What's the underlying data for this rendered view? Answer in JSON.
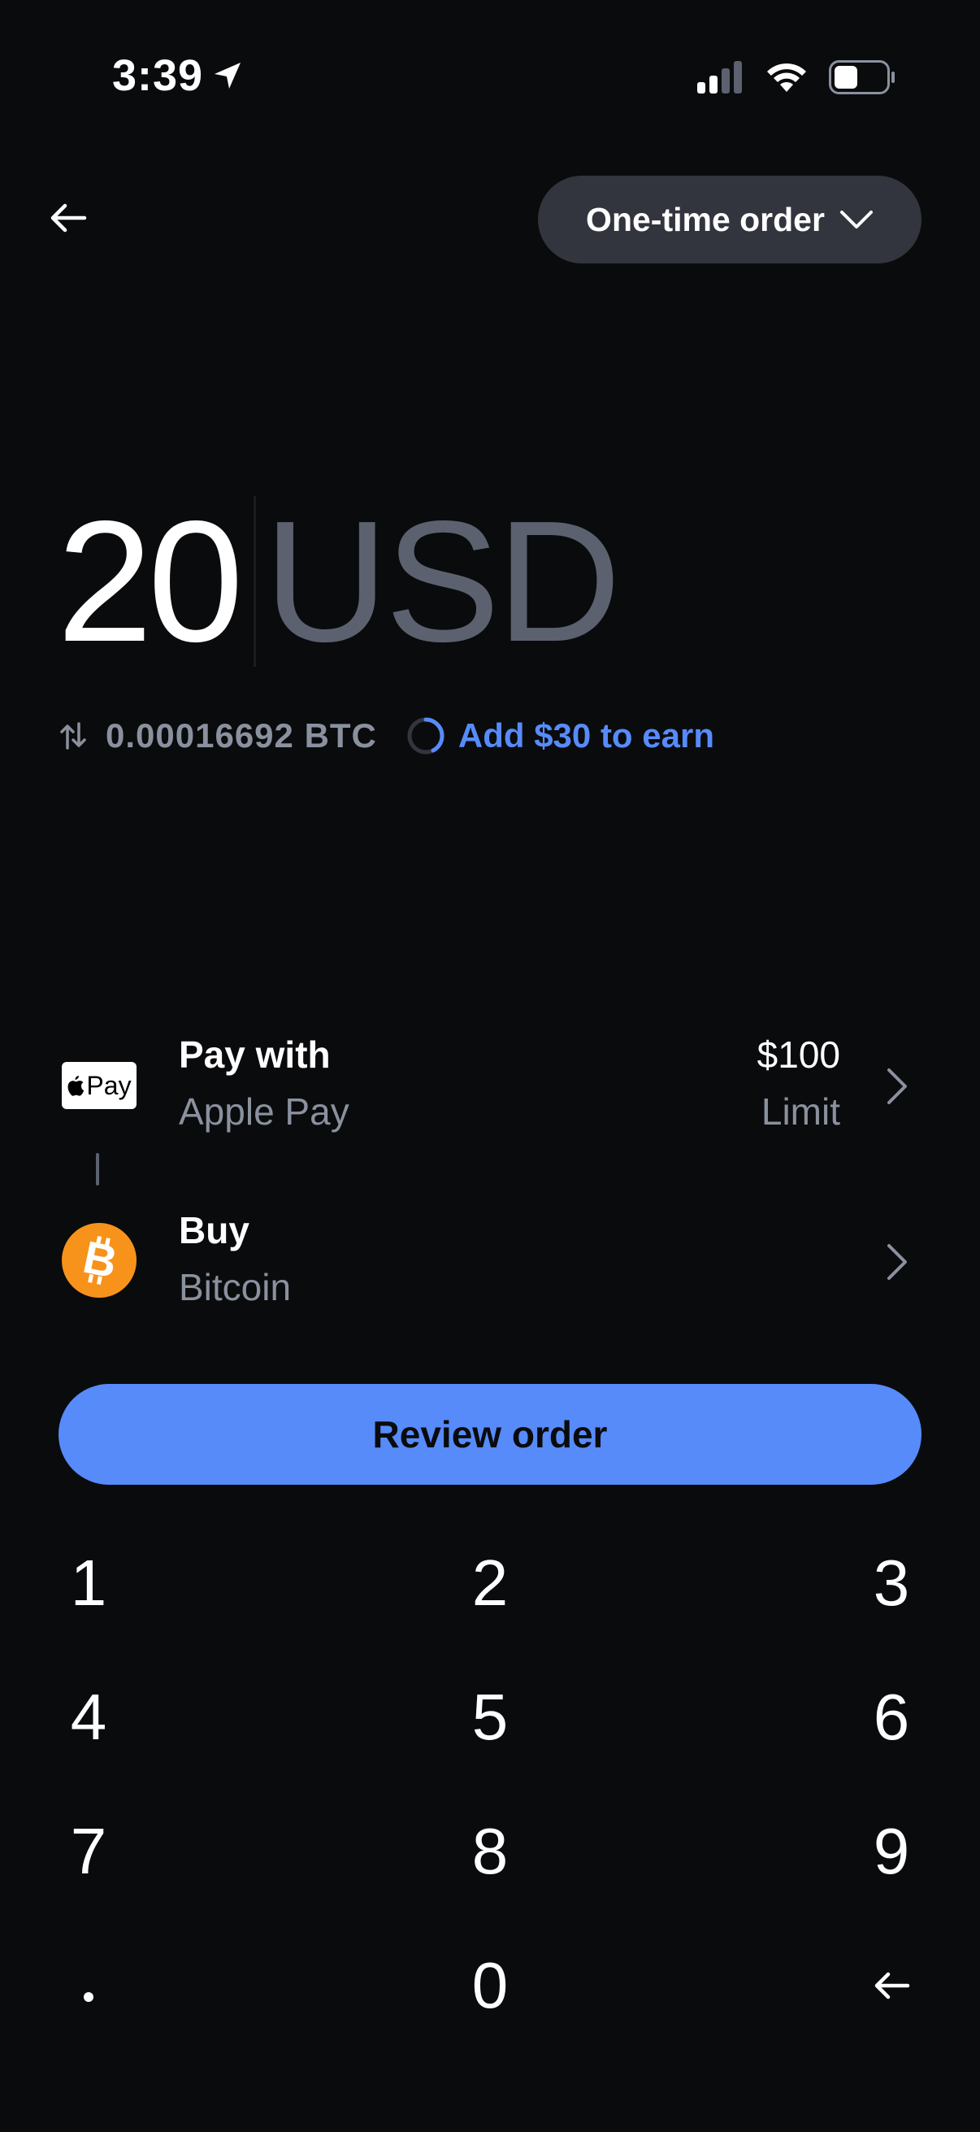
{
  "status_bar": {
    "time": "3:39"
  },
  "header": {
    "order_type_label": "One-time order"
  },
  "amount": {
    "value": "20",
    "currency": "USD"
  },
  "conversion": {
    "crypto_amount": "0.00016692 BTC",
    "earn_prompt": "Add $30 to earn"
  },
  "payment": {
    "title": "Pay with",
    "method": "Apple Pay",
    "badge_text": "Pay",
    "limit_value": "$100",
    "limit_label": "Limit"
  },
  "asset": {
    "title": "Buy",
    "name": "Bitcoin",
    "icon_color": "#f7931a"
  },
  "review_button": {
    "label": "Review order"
  },
  "keypad": {
    "keys": [
      "1",
      "2",
      "3",
      "4",
      "5",
      "6",
      "7",
      "8",
      "9",
      ".",
      "0",
      "backspace"
    ]
  },
  "colors": {
    "background": "#0a0b0d",
    "accent": "#578bfa",
    "muted_text": "#8a919e",
    "pill": "#32353d"
  },
  "icons": {
    "back": "arrow-left-icon",
    "order_dropdown": "chevron-down-icon",
    "swap": "swap-arrows-icon",
    "earn": "progress-ring-icon",
    "row_nav": "chevron-right-icon",
    "asset": "bitcoin-icon",
    "delete": "backspace-arrow-icon"
  }
}
